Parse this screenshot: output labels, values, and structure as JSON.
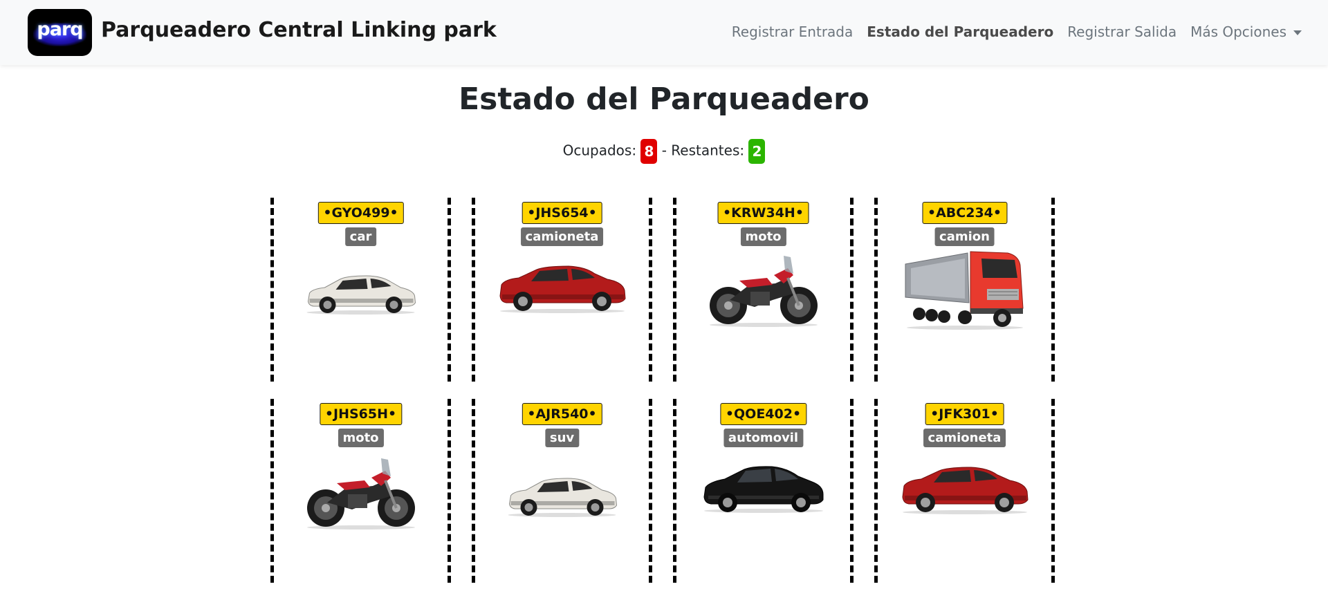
{
  "navbar": {
    "logo_text": "parq",
    "brand": "Parqueadero Central Linking park",
    "links": [
      {
        "label": "Registrar Entrada"
      },
      {
        "label": "Estado del Parqueadero"
      },
      {
        "label": "Registrar Salida"
      },
      {
        "label": "Más Opciones"
      }
    ]
  },
  "main": {
    "title": "Estado del Parqueadero",
    "occupied_label": "Ocupados:",
    "occupied_count": "8",
    "separator": "-",
    "remaining_label": "Restantes:",
    "remaining_count": "2"
  },
  "slots": [
    {
      "plate": "•GYO499•",
      "type": "car",
      "icon": "suv-white-icon"
    },
    {
      "plate": "•JHS654•",
      "type": "camioneta",
      "icon": "suv-red-icon"
    },
    {
      "plate": "•KRW34H•",
      "type": "moto",
      "icon": "motorcycle-icon"
    },
    {
      "plate": "•ABC234•",
      "type": "camion",
      "icon": "truck-icon"
    },
    {
      "plate": "•JHS65H•",
      "type": "moto",
      "icon": "motorcycle-icon"
    },
    {
      "plate": "•AJR540•",
      "type": "suv",
      "icon": "suv-white-icon"
    },
    {
      "plate": "•QOE402•",
      "type": "automovil",
      "icon": "hatchback-black-icon"
    },
    {
      "plate": "•JFK301•",
      "type": "camioneta",
      "icon": "suv-red-icon"
    }
  ]
}
